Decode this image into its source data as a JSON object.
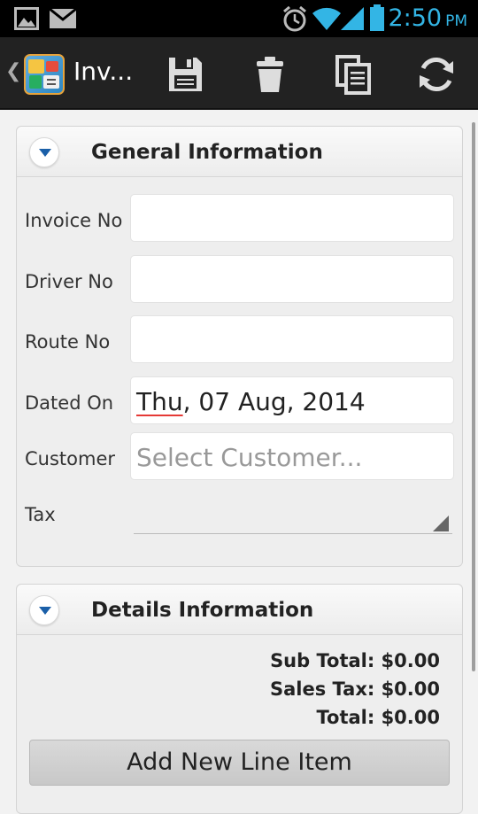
{
  "status_bar": {
    "time": "2:50",
    "ampm": "PM",
    "icons": [
      "image-icon",
      "mail-icon",
      "alarm-icon",
      "wifi-icon",
      "signal-icon",
      "battery-icon"
    ],
    "accent_color": "#33b5e5"
  },
  "action_bar": {
    "title": "Inv...",
    "actions": [
      "save-icon",
      "trash-icon",
      "copy-icon",
      "refresh-icon"
    ]
  },
  "general_panel": {
    "title": "General Information",
    "fields": {
      "invoice_no": {
        "label": "Invoice No",
        "value": ""
      },
      "driver_no": {
        "label": "Driver No",
        "value": ""
      },
      "route_no": {
        "label": "Route No",
        "value": ""
      },
      "dated_on": {
        "label": "Dated On",
        "value_day": "Thu",
        "value_rest": ", 07 Aug, 2014"
      },
      "customer": {
        "label": "Customer",
        "placeholder": "Select Customer..."
      },
      "tax": {
        "label": "Tax",
        "value": ""
      }
    }
  },
  "details_panel": {
    "title": "Details Information",
    "sub_total": "Sub Total: $0.00",
    "sales_tax": "Sales Tax: $0.00",
    "total": "Total: $0.00",
    "add_button": "Add New Line Item"
  }
}
